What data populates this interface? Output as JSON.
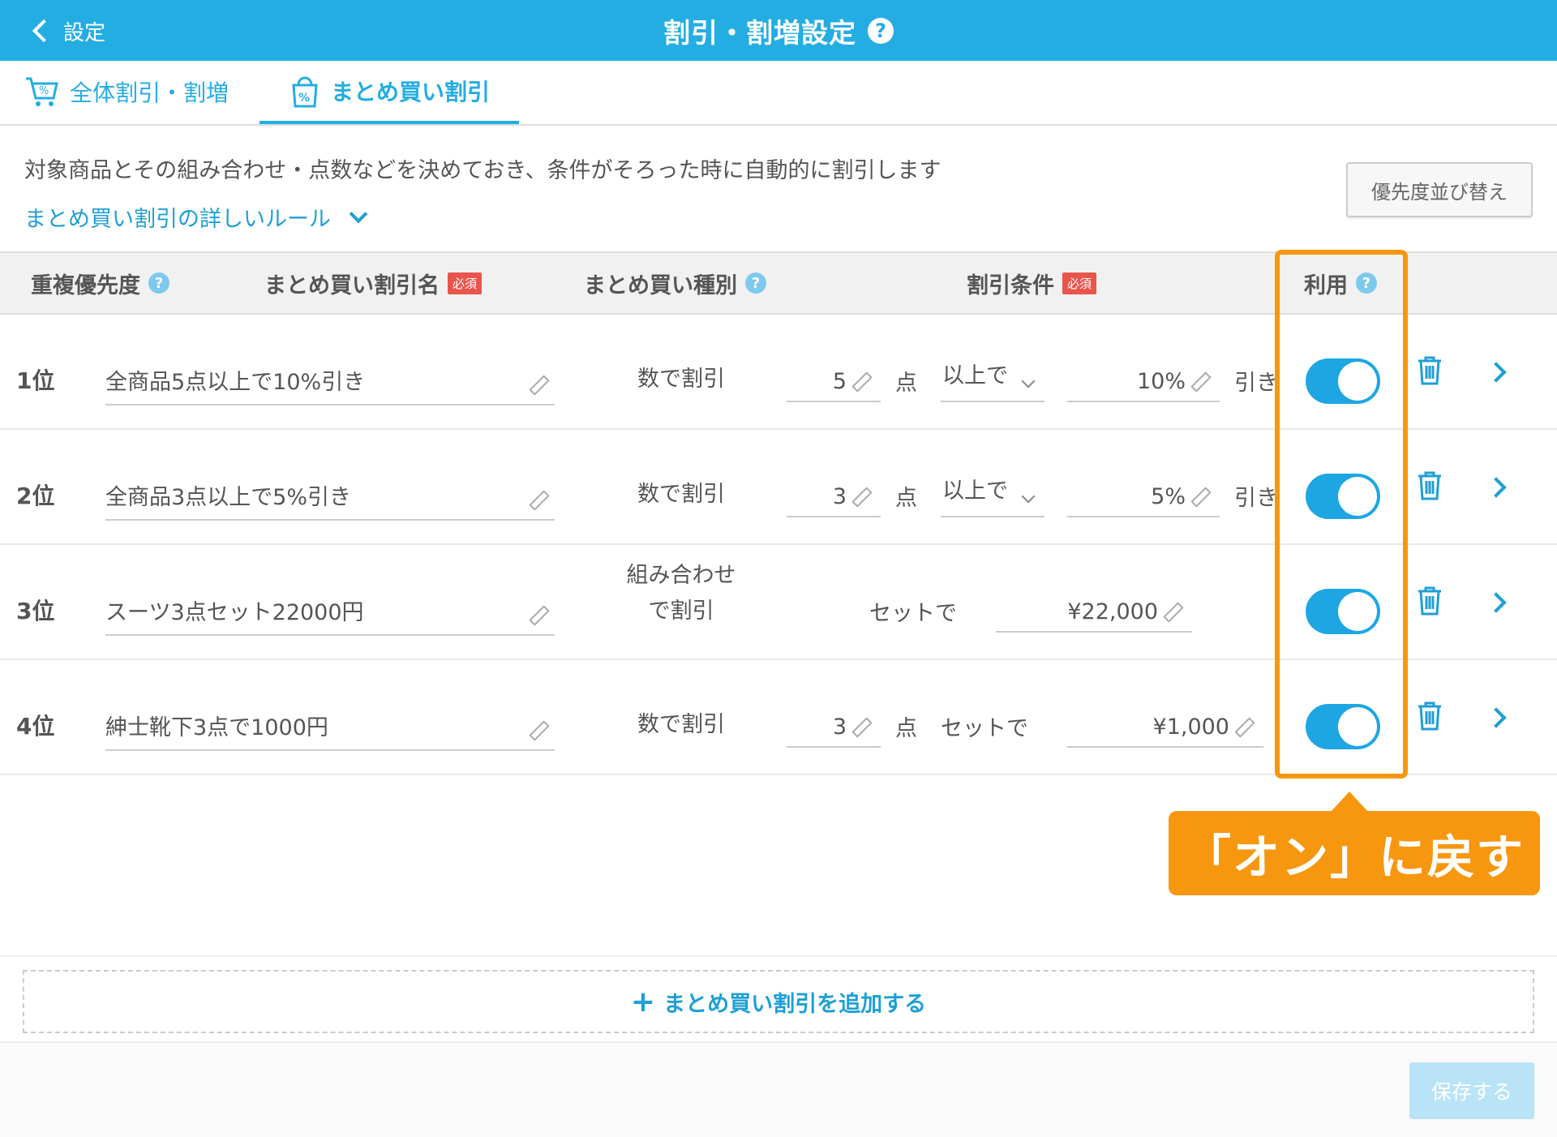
{
  "header": {
    "back_label": "設定",
    "title": "割引・割増設定"
  },
  "tabs": [
    {
      "label": "全体割引・割増",
      "active": false
    },
    {
      "label": "まとめ買い割引",
      "active": true
    }
  ],
  "intro": {
    "description": "対象商品とその組み合わせ・点数などを決めておき、条件がそろった時に自動的に割引します",
    "rules_link": "まとめ買い割引の詳しいルール",
    "sort_button": "優先度並び替え"
  },
  "table": {
    "headers": {
      "priority": "重複優先度",
      "name": "まとめ買い割引名",
      "type": "まとめ買い種別",
      "condition": "割引条件",
      "use": "利用",
      "required": "必須"
    },
    "rows": [
      {
        "rank": "1位",
        "name": "全商品5点以上で10%引き",
        "type": "数で割引",
        "qty": "5",
        "unit": "点",
        "cond": "以上で",
        "amount": "10%",
        "suffix": "引き",
        "enabled": true
      },
      {
        "rank": "2位",
        "name": "全商品3点以上で5%引き",
        "type": "数で割引",
        "qty": "3",
        "unit": "点",
        "cond": "以上で",
        "amount": "5%",
        "suffix": "引き",
        "enabled": true
      },
      {
        "rank": "3位",
        "name": "スーツ3点セット22000円",
        "type_line1": "組み合わせ",
        "type_line2": "で割引",
        "cond": "セットで",
        "amount": "¥22,000",
        "enabled": true
      },
      {
        "rank": "4位",
        "name": "紳士靴下3点で1000円",
        "type": "数で割引",
        "qty": "3",
        "unit": "点",
        "cond": "セットで",
        "amount": "¥1,000",
        "enabled": true
      }
    ]
  },
  "callout": "「オン」に戻す",
  "add_button": "まとめ買い割引を追加する",
  "save_button": "保存する",
  "colors": {
    "brand": "#24ade3",
    "highlight": "#f7970f",
    "required": "#e9554d"
  }
}
